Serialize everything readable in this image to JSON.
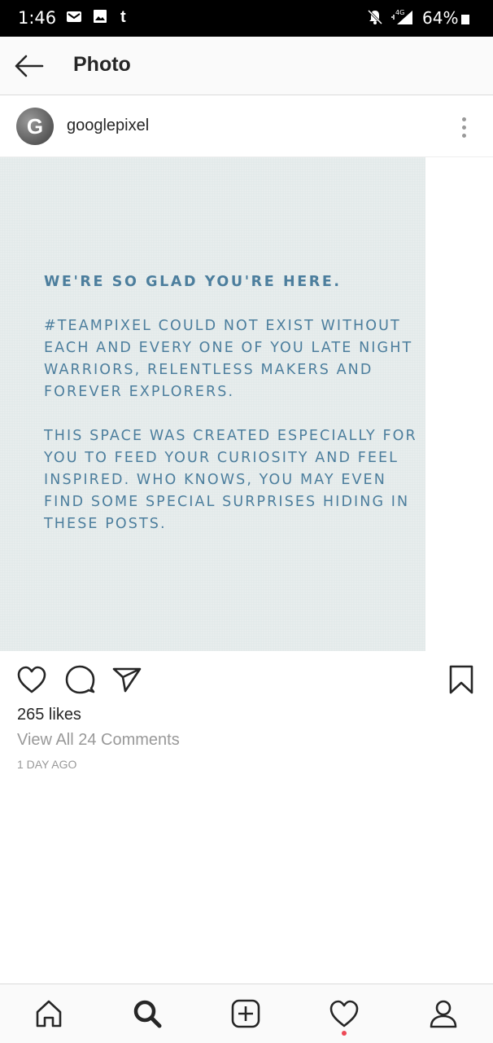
{
  "status_bar": {
    "time": "1:46",
    "battery": "64%",
    "network": "4G",
    "icons": [
      "email-icon",
      "image-icon",
      "tumblr-icon",
      "notifications-muted-icon",
      "signal-icon",
      "battery-icon"
    ]
  },
  "app_bar": {
    "title": "Photo",
    "back_icon": "back-arrow-icon"
  },
  "post": {
    "username": "googlepixel",
    "avatar_letter": "G",
    "image_text": {
      "heading": "WE'RE SO GLAD YOU'RE HERE.",
      "paragraph_1": "#TEAMPIXEL COULD NOT EXIST WITHOUT EACH AND EVERY ONE OF YOU LATE NIGHT WARRIORS, RELENTLESS MAKERS AND FOREVER EXPLORERS.",
      "paragraph_2": "THIS SPACE WAS CREATED ESPECIALLY FOR YOU TO FEED YOUR CURIOSITY AND FEEL INSPIRED. WHO KNOWS, YOU MAY EVEN FIND SOME SPECIAL SURPRISES HIDING IN THESE POSTS."
    },
    "likes": "265 likes",
    "comments_link": "View All 24 Comments",
    "time_ago": "1 DAY AGO"
  },
  "tab_bar": {
    "items": [
      "home-icon",
      "search-icon",
      "new-post-icon",
      "activity-icon",
      "profile-icon"
    ]
  },
  "colors": {
    "image_background": "#e3eaea",
    "image_text": "#4c7e9d",
    "notification_dot": "#ed4956"
  }
}
